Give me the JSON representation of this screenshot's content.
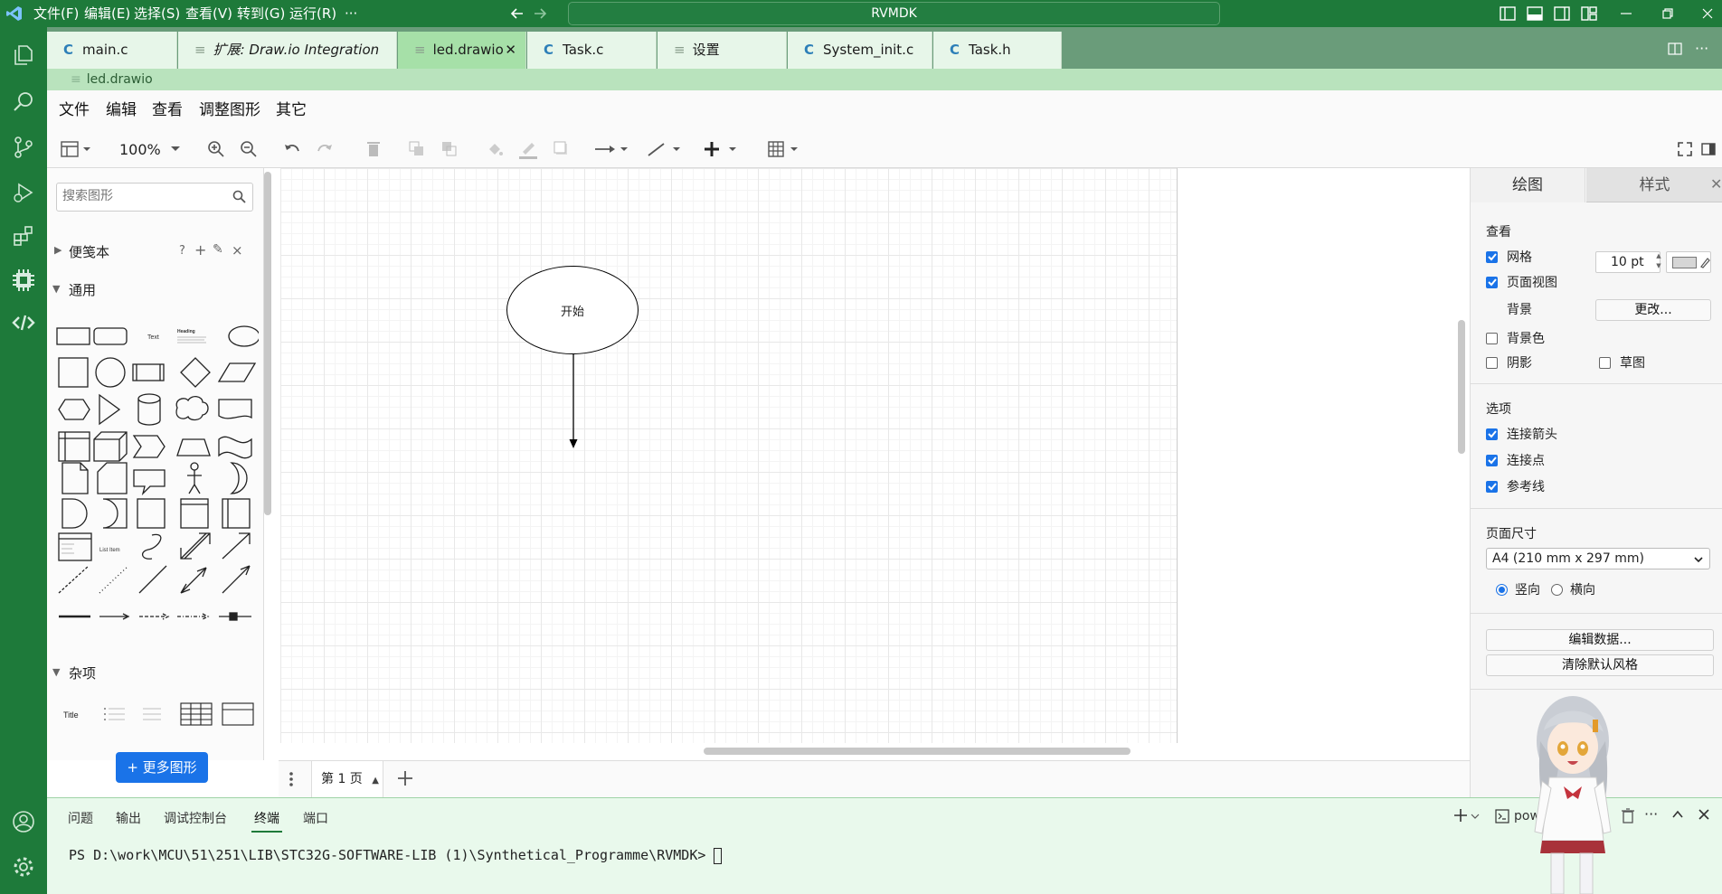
{
  "titlebar": {
    "menus": [
      "文件(F)",
      "编辑(E)",
      "选择(S)",
      "查看(V)",
      "转到(G)",
      "运行(R)",
      "···"
    ],
    "search_text": "RVMDK"
  },
  "tabs": [
    {
      "label": "main.c",
      "kind": "C"
    },
    {
      "label": "扩展: Draw.io Integration",
      "kind": "file"
    },
    {
      "label": "led.drawio",
      "kind": "file",
      "active": true
    },
    {
      "label": "Task.c",
      "kind": "C"
    },
    {
      "label": "设置",
      "kind": "file"
    },
    {
      "label": "System_init.c",
      "kind": "C"
    },
    {
      "label": "Task.h",
      "kind": "C"
    }
  ],
  "breadcrumb": "led.drawio",
  "drawio": {
    "menus": [
      "文件",
      "编辑",
      "查看",
      "调整图形",
      "其它"
    ],
    "zoom": "100%",
    "search_placeholder": "搜索图形",
    "sections": {
      "scratchpad": "便笺本",
      "scratchpad_tools": [
        "?",
        "+",
        "✎",
        "×"
      ],
      "general": "通用",
      "misc": "杂项"
    },
    "more_shapes": "+ 更多图形",
    "page_tab": "第 1 页",
    "diagram": {
      "start_label": "开始"
    },
    "shape_text": {
      "text": "Text",
      "heading": "Heading",
      "title": "Title",
      "list_item": "List Item"
    },
    "right_panel": {
      "tabs": [
        "绘图",
        "样式"
      ],
      "view_title": "查看",
      "grid": "网格",
      "grid_size": "10 pt",
      "page_view": "页面视图",
      "background": "背景",
      "change_btn": "更改...",
      "bg_color": "背景色",
      "shadow": "阴影",
      "sketch": "草图",
      "options_title": "选项",
      "connection_arrows": "连接箭头",
      "connection_points": "连接点",
      "guides": "参考线",
      "page_size_title": "页面尺寸",
      "page_size_value": "A4 (210 mm x 297 mm)",
      "portrait": "竖向",
      "landscape": "横向",
      "edit_data": "编辑数据...",
      "clear_style": "清除默认风格"
    }
  },
  "panel": {
    "tabs": [
      "问题",
      "输出",
      "调试控制台",
      "终端",
      "端口"
    ],
    "active_tab": "终端",
    "terminal_label": "pow",
    "terminal_line": "PS D:\\work\\MCU\\51\\251\\LIB\\STC32G-SOFTWARE-LIB (1)\\Synthetical_Programme\\RVMDK> "
  },
  "colors": {
    "accent_green": "#1e7a3a",
    "tab_active": "#a6e0a8",
    "checkbox_blue": "#1a73e8",
    "more_shapes_btn": "#1a73e8"
  }
}
